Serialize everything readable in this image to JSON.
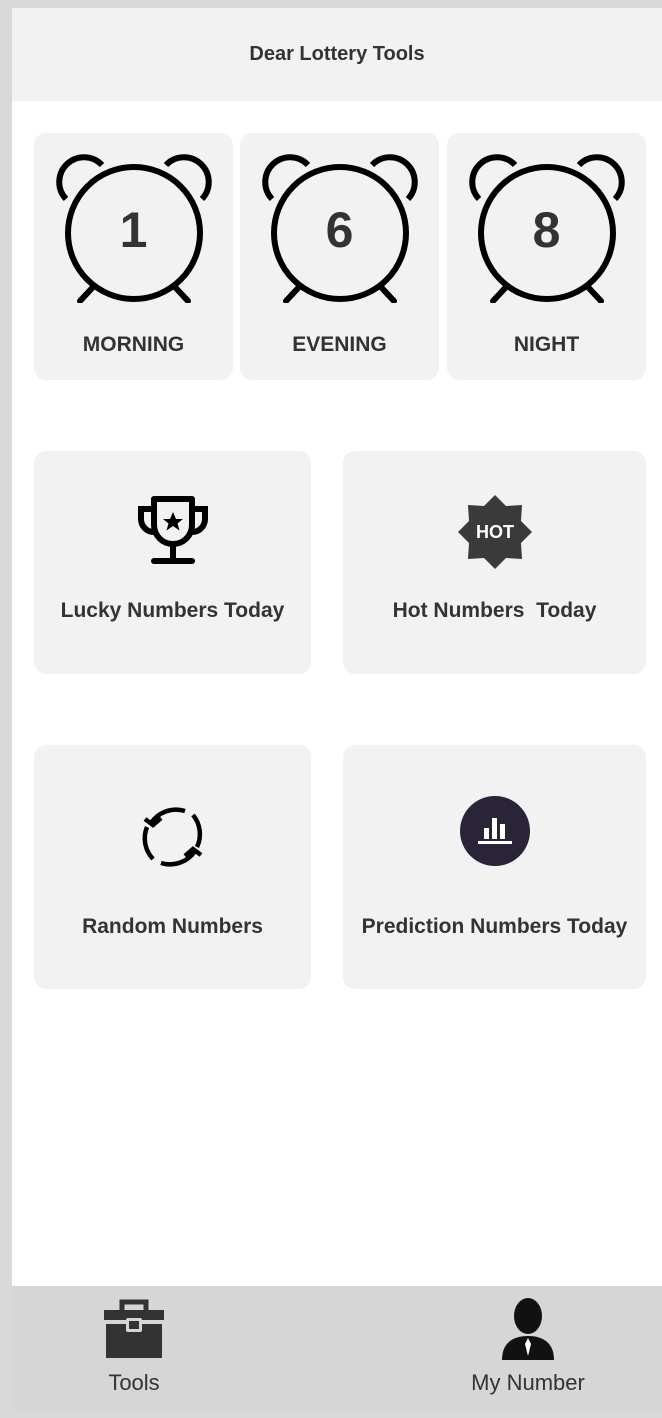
{
  "header": {
    "title": "Dear Lottery Tools"
  },
  "draws": [
    {
      "number": "1",
      "label": "MORNING"
    },
    {
      "number": "6",
      "label": "EVENING"
    },
    {
      "number": "8",
      "label": "NIGHT"
    }
  ],
  "tools": [
    {
      "label": "Lucky Numbers Today",
      "icon": "trophy-icon"
    },
    {
      "label": "Hot Numbers  Today",
      "icon": "hot-badge-icon",
      "badge_text": "HOT"
    },
    {
      "label": "Random Numbers",
      "icon": "refresh-icon"
    },
    {
      "label": "Prediction Numbers Today",
      "icon": "bar-chart-icon"
    }
  ],
  "tabbar": {
    "items": [
      {
        "label": "Tools",
        "icon": "toolbox-icon"
      },
      {
        "label": "My Number",
        "icon": "user-icon"
      }
    ]
  },
  "colors": {
    "background": "#ffffff",
    "card": "#f2f2f2",
    "text": "#333333",
    "tabbar": "#d6d6d6",
    "chart_icon_bg": "#2a2438"
  }
}
